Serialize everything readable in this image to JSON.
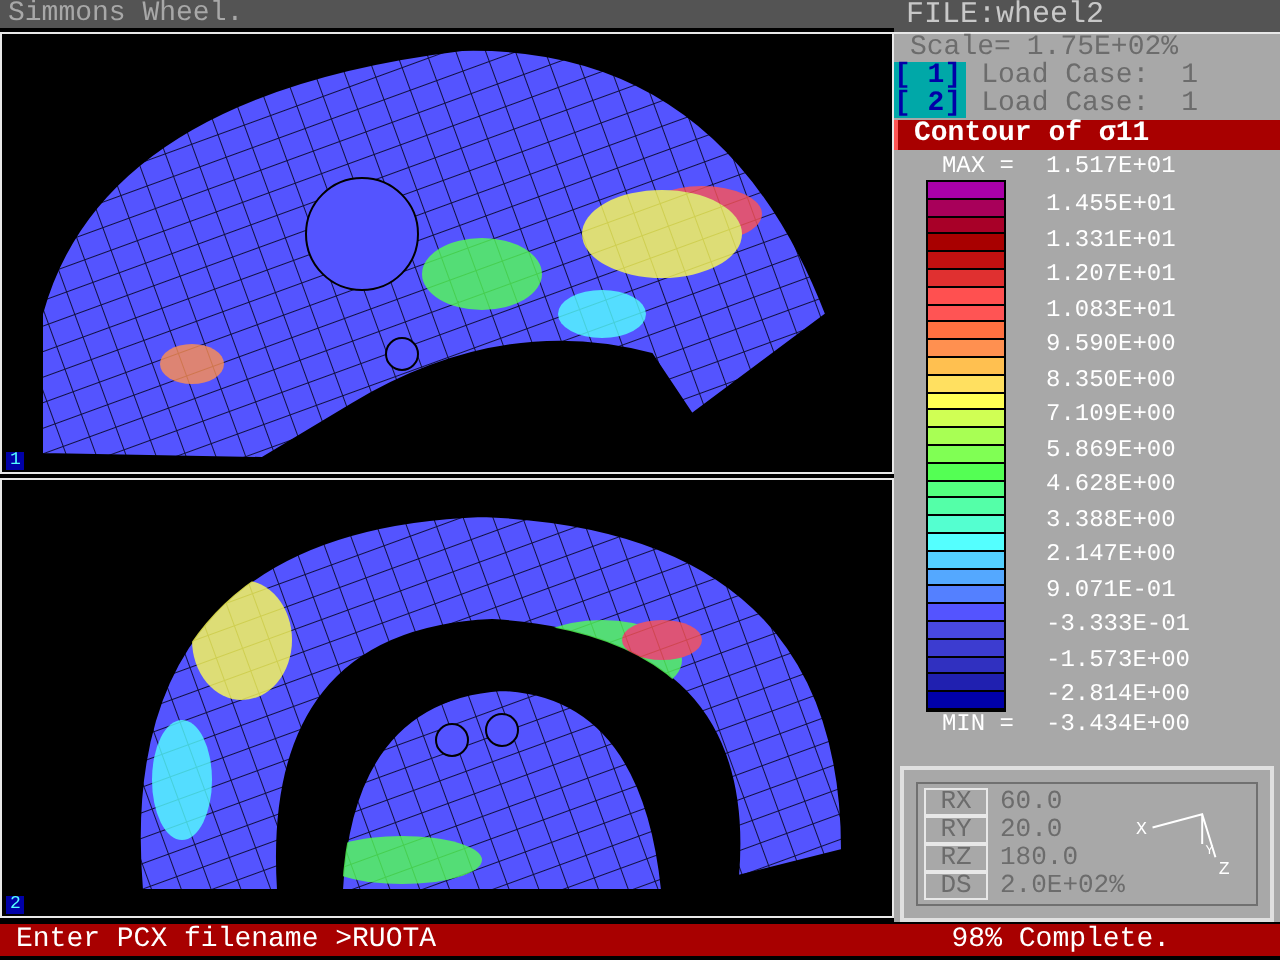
{
  "window": {
    "title": "Simmons Wheel."
  },
  "viewports": [
    {
      "label": "1",
      "kind": "sector"
    },
    {
      "label": "2",
      "kind": "ring"
    }
  ],
  "file_bar": {
    "title": "FILE:wheel2"
  },
  "scale": {
    "label": "Scale=",
    "value": "1.75E+02%"
  },
  "load_cases": [
    {
      "index": "[ 1]",
      "label": "Load Case:",
      "value": "1"
    },
    {
      "index": "[ 2]",
      "label": "Load Case:",
      "value": "1"
    }
  ],
  "contour": {
    "title": "Contour of σ11",
    "max_label": "MAX =",
    "max_value": "1.517E+01",
    "min_label": "MIN =",
    "min_value": "-3.434E+00",
    "ticks": [
      "1.455E+01",
      "1.331E+01",
      "1.207E+01",
      "1.083E+01",
      "9.590E+00",
      "8.350E+00",
      "7.109E+00",
      "5.869E+00",
      "4.628E+00",
      "3.388E+00",
      "2.147E+00",
      "9.071E-01",
      "-3.333E-01",
      "-1.573E+00",
      "-2.814E+00"
    ],
    "bands": [
      {
        "color": "#a800a8"
      },
      {
        "color": "#a8005a"
      },
      {
        "color": "#a80028"
      },
      {
        "color": "#a80000"
      },
      {
        "color": "#c01010"
      },
      {
        "color": "#e03030"
      },
      {
        "color": "#ff5050"
      },
      {
        "color": "#ff5454"
      },
      {
        "color": "#ff7040"
      },
      {
        "color": "#ff9050"
      },
      {
        "color": "#ffc050"
      },
      {
        "color": "#ffe060"
      },
      {
        "color": "#ffff54"
      },
      {
        "color": "#d0ff54"
      },
      {
        "color": "#a8ff54"
      },
      {
        "color": "#80ff54"
      },
      {
        "color": "#54ff54"
      },
      {
        "color": "#54ff80"
      },
      {
        "color": "#54ffa8"
      },
      {
        "color": "#54ffd0"
      },
      {
        "color": "#54ffff"
      },
      {
        "color": "#54d0ff"
      },
      {
        "color": "#54a8ff"
      },
      {
        "color": "#5480ff"
      },
      {
        "color": "#5454ff"
      },
      {
        "color": "#4848e0"
      },
      {
        "color": "#3c3cd0"
      },
      {
        "color": "#3030c0"
      },
      {
        "color": "#2020b0"
      },
      {
        "color": "#0000a8"
      }
    ]
  },
  "view": {
    "params": [
      {
        "name": "RX",
        "value": "60.0"
      },
      {
        "name": "RY",
        "value": "20.0"
      },
      {
        "name": "RZ",
        "value": "180.0"
      },
      {
        "name": "DS",
        "value": "2.0E+02%"
      }
    ],
    "axes": [
      "X",
      "Y",
      "Z"
    ]
  },
  "status_bar": {
    "prompt": "Enter PCX filename >RUOTA",
    "progress": "98% Complete."
  }
}
